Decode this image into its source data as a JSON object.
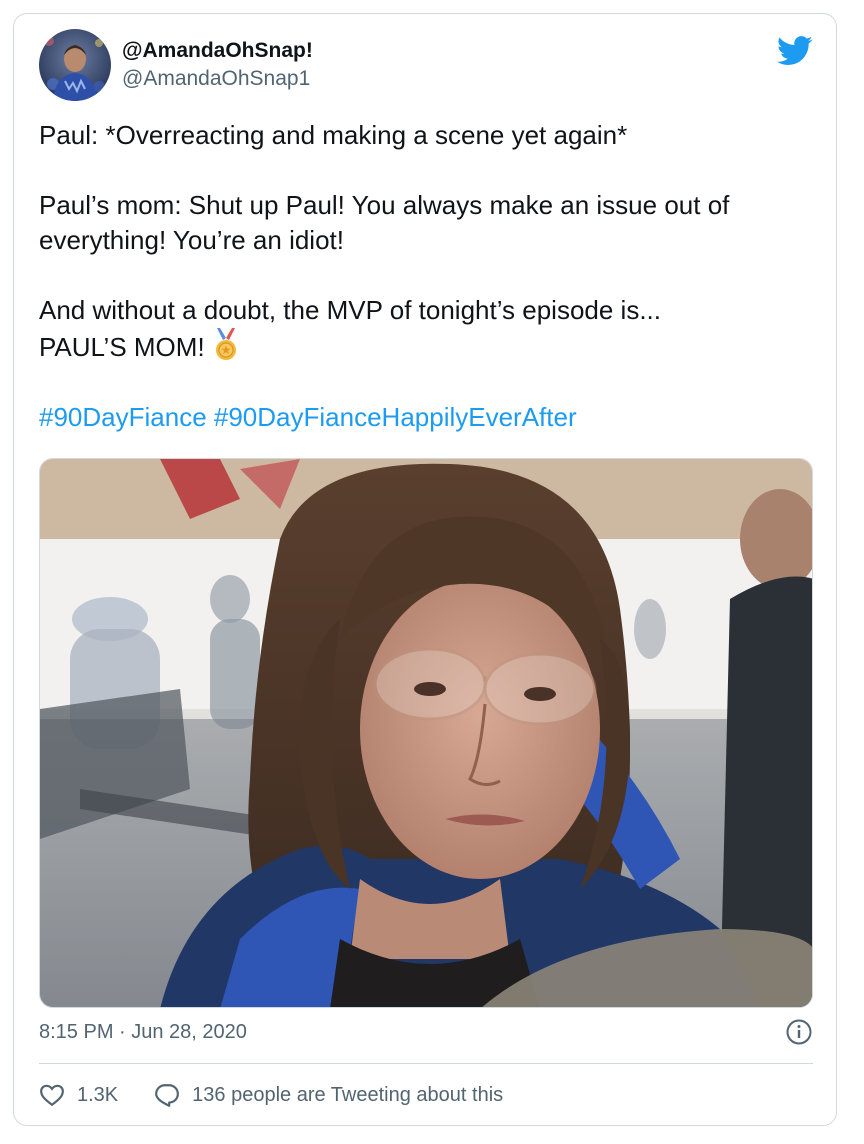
{
  "tweet": {
    "display_name": "@AmandaOhSnap!",
    "handle": "@AmandaOhSnap1",
    "paragraphs": [
      "Paul: *Overreacting and making a scene yet again*",
      "Paul’s mom: Shut up Paul! You always make an issue out of everything! You’re an idiot!",
      "And without a doubt, the MVP of tonight’s episode is...",
      "PAUL’S MOM!"
    ],
    "hashtags": [
      "#90DayFiance",
      "#90DayFianceHappilyEverAfter"
    ],
    "timestamp": "8:15 PM · Jun 28, 2020"
  },
  "actions": {
    "likes": "1.3K",
    "replies_label": "136 people are Tweeting about this"
  },
  "icons": {
    "brand": "twitter-bird-icon",
    "medal": "medal-emoji-icon",
    "info": "info-icon",
    "like": "heart-icon",
    "reply": "speech-bubble-icon"
  },
  "colors": {
    "accent": "#1d9bf0",
    "text": "#0f1419",
    "secondary": "#536471",
    "border": "#cfd9de"
  }
}
